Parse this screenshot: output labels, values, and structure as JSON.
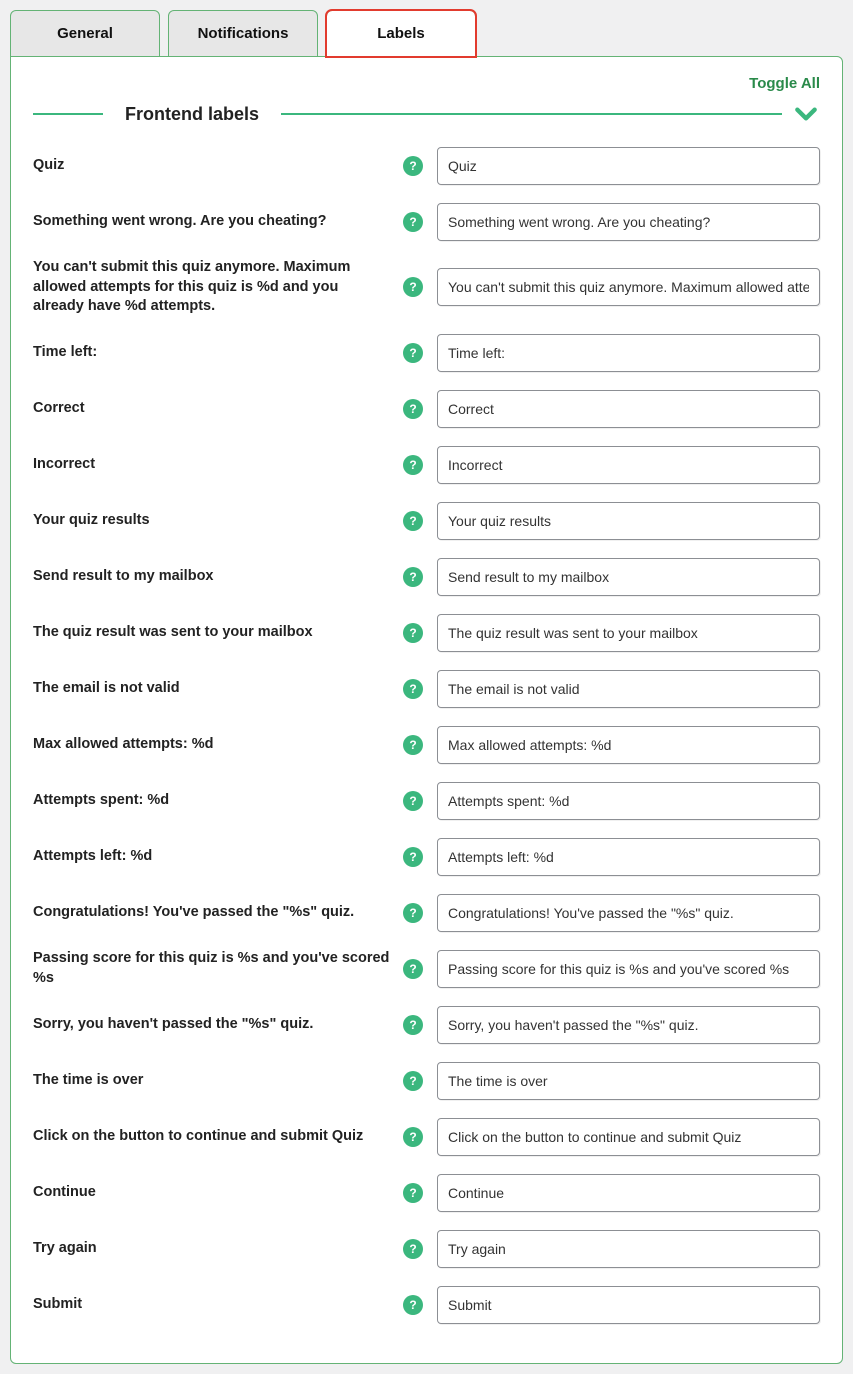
{
  "tabs": [
    {
      "label": "General",
      "active": false
    },
    {
      "label": "Notifications",
      "active": false
    },
    {
      "label": "Labels",
      "active": true
    }
  ],
  "toggle_all_label": "Toggle All",
  "section_title": "Frontend labels",
  "rows": [
    {
      "label": "Quiz",
      "value": "Quiz"
    },
    {
      "label": "Something went wrong. Are you cheating?",
      "value": "Something went wrong. Are you cheating?"
    },
    {
      "label": "You can't submit this quiz anymore. Maximum allowed attempts for this quiz is %d and you already have %d attempts.",
      "value": "You can't submit this quiz anymore. Maximum allowed attempts for this quiz is %d and you already have %d attempts."
    },
    {
      "label": "Time left:",
      "value": "Time left:"
    },
    {
      "label": "Correct",
      "value": "Correct"
    },
    {
      "label": "Incorrect",
      "value": "Incorrect"
    },
    {
      "label": "Your quiz results",
      "value": "Your quiz results"
    },
    {
      "label": "Send result to my mailbox",
      "value": "Send result to my mailbox"
    },
    {
      "label": "The quiz result was sent to your mailbox",
      "value": "The quiz result was sent to your mailbox"
    },
    {
      "label": "The email is not valid",
      "value": "The email is not valid"
    },
    {
      "label": "Max allowed attempts: %d",
      "value": "Max allowed attempts: %d"
    },
    {
      "label": "Attempts spent: %d",
      "value": "Attempts spent: %d"
    },
    {
      "label": "Attempts left: %d",
      "value": "Attempts left: %d"
    },
    {
      "label": "Congratulations! You've passed the \"%s\" quiz.",
      "value": "Congratulations! You've passed the \"%s\" quiz."
    },
    {
      "label": "Passing score for this quiz is %s and you've scored %s",
      "value": "Passing score for this quiz is %s and you've scored %s"
    },
    {
      "label": "Sorry, you haven't passed the \"%s\" quiz.",
      "value": "Sorry, you haven't passed the \"%s\" quiz."
    },
    {
      "label": "The time is over",
      "value": "The time is over"
    },
    {
      "label": "Click on the button to continue and submit Quiz",
      "value": "Click on the button to continue and submit Quiz"
    },
    {
      "label": "Continue",
      "value": "Continue"
    },
    {
      "label": "Try again",
      "value": "Try again"
    },
    {
      "label": "Submit",
      "value": "Submit"
    }
  ]
}
